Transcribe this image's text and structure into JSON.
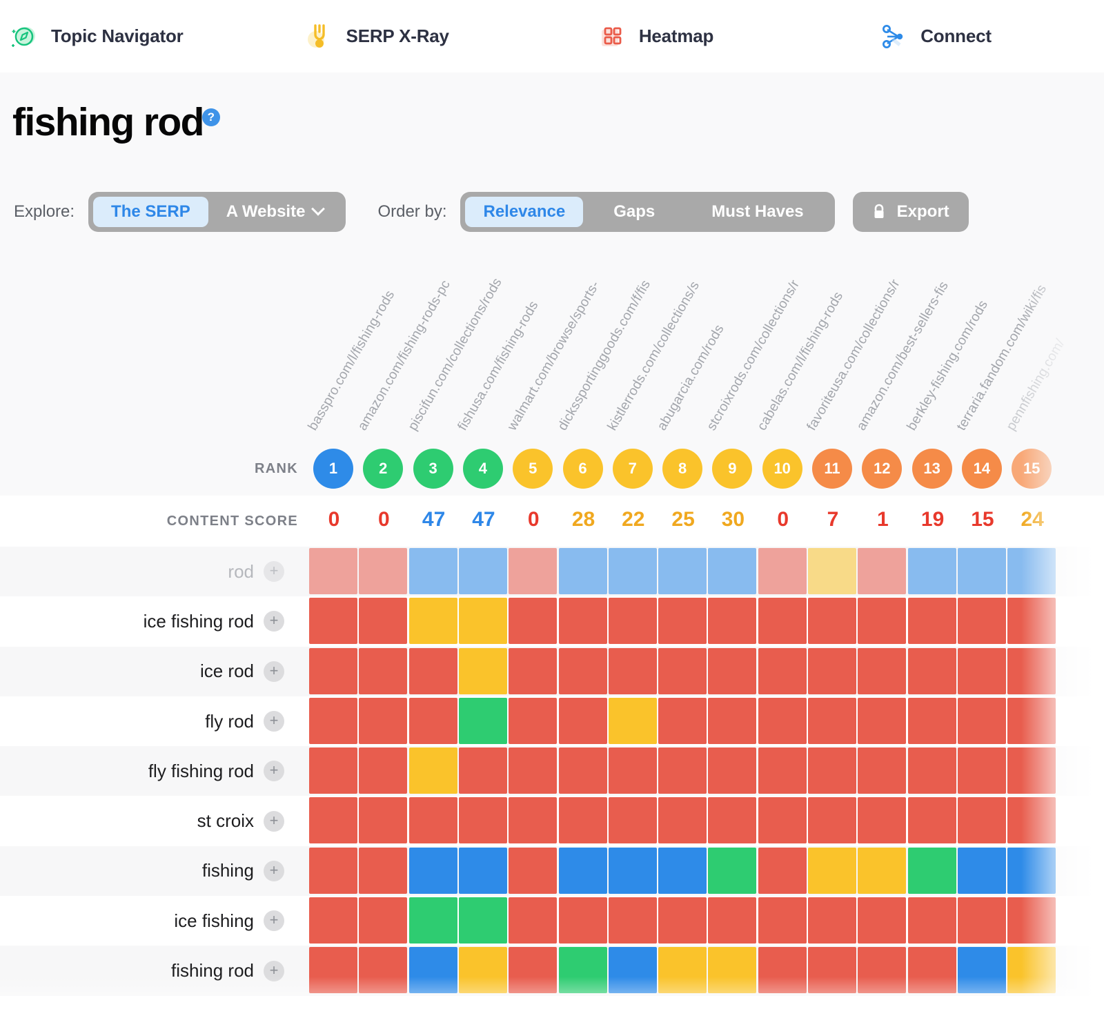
{
  "nav": {
    "items": [
      {
        "label": "Topic Navigator",
        "icon": "compass-icon",
        "active": false
      },
      {
        "label": "SERP X-Ray",
        "icon": "medal-icon",
        "active": false
      },
      {
        "label": "Heatmap",
        "icon": "grid-squares-icon",
        "active": true
      },
      {
        "label": "Connect",
        "icon": "node-graph-icon",
        "active": false
      }
    ],
    "active_underline_color": "#ea5a48"
  },
  "header": {
    "keyword": "fishing rod",
    "help_badge": "?",
    "explore_label": "Explore:",
    "explore_options": [
      {
        "label": "The SERP",
        "active": true,
        "has_chevron": false
      },
      {
        "label": "A Website",
        "active": false,
        "has_chevron": true
      }
    ],
    "order_label": "Order by:",
    "order_options": [
      {
        "label": "Relevance",
        "active": true
      },
      {
        "label": "Gaps",
        "active": false
      },
      {
        "label": "Must Haves",
        "active": false
      }
    ],
    "export_label": "Export",
    "export_icon": "lock-icon"
  },
  "table": {
    "rank_row_label": "RANK",
    "score_row_label": "CONTENT SCORE",
    "add_icon": "plus-icon",
    "columns": [
      {
        "url": "basspro.com/l/fishing-rods",
        "rank": 1,
        "rank_color": "#2e8be8",
        "score": 0,
        "score_color": "#e8392c"
      },
      {
        "url": "amazon.com/fishing-rods-pc",
        "rank": 2,
        "rank_color": "#2ecc71",
        "score": 0,
        "score_color": "#e8392c"
      },
      {
        "url": "piscifun.com/collections/rods",
        "rank": 3,
        "rank_color": "#2ecc71",
        "score": 47,
        "score_color": "#2e87e8"
      },
      {
        "url": "fishusa.com/fishing-rods",
        "rank": 4,
        "rank_color": "#2ecc71",
        "score": 47,
        "score_color": "#2e87e8"
      },
      {
        "url": "walmart.com/browse/sports-",
        "rank": 5,
        "rank_color": "#fac32b",
        "score": 0,
        "score_color": "#e8392c"
      },
      {
        "url": "dickssportinggoods.com/f/fis",
        "rank": 6,
        "rank_color": "#fac32b",
        "score": 28,
        "score_color": "#f0a81f"
      },
      {
        "url": "kistlerrods.com/collections/s",
        "rank": 7,
        "rank_color": "#fac32b",
        "score": 22,
        "score_color": "#f0a81f"
      },
      {
        "url": "abugarcia.com/rods",
        "rank": 8,
        "rank_color": "#fac32b",
        "score": 25,
        "score_color": "#f0a81f"
      },
      {
        "url": "stcroixrods.com/collections/r",
        "rank": 9,
        "rank_color": "#fac32b",
        "score": 30,
        "score_color": "#f0a81f"
      },
      {
        "url": "cabelas.com/l/fishing-rods",
        "rank": 10,
        "rank_color": "#fac32b",
        "score": 0,
        "score_color": "#e8392c"
      },
      {
        "url": "favoriteusa.com/collections/r",
        "rank": 11,
        "rank_color": "#f58b48",
        "score": 7,
        "score_color": "#e8392c"
      },
      {
        "url": "amazon.com/best-sellers-fis",
        "rank": 12,
        "rank_color": "#f58b48",
        "score": 1,
        "score_color": "#e8392c"
      },
      {
        "url": "berkley-fishing.com/rods",
        "rank": 13,
        "rank_color": "#f58b48",
        "score": 19,
        "score_color": "#e8392c"
      },
      {
        "url": "terraria.fandom.com/wiki/fis",
        "rank": 14,
        "rank_color": "#f58b48",
        "score": 15,
        "score_color": "#e8392c"
      },
      {
        "url": "pennfishing.com/",
        "rank": 15,
        "rank_color": "#f8a877",
        "score": 24,
        "score_color": "#f0a81f"
      }
    ],
    "rows": [
      {
        "term": "fishing rod",
        "faded": false,
        "cells": [
          "red",
          "red",
          "blue",
          "yellow",
          "red",
          "green",
          "blue",
          "yellow",
          "yellow",
          "red",
          "red",
          "red",
          "red",
          "blue",
          "yellow"
        ]
      },
      {
        "term": "ice fishing",
        "faded": false,
        "cells": [
          "red",
          "red",
          "green",
          "green",
          "red",
          "red",
          "red",
          "red",
          "red",
          "red",
          "red",
          "red",
          "red",
          "red",
          "red"
        ]
      },
      {
        "term": "fishing",
        "faded": false,
        "cells": [
          "red",
          "red",
          "blue",
          "blue",
          "red",
          "blue",
          "blue",
          "blue",
          "green",
          "red",
          "yellow",
          "yellow",
          "green",
          "blue",
          "blue"
        ]
      },
      {
        "term": "st croix",
        "faded": false,
        "cells": [
          "red",
          "red",
          "red",
          "red",
          "red",
          "red",
          "red",
          "red",
          "red",
          "red",
          "red",
          "red",
          "red",
          "red",
          "red"
        ]
      },
      {
        "term": "fly fishing rod",
        "faded": false,
        "cells": [
          "red",
          "red",
          "yellow",
          "red",
          "red",
          "red",
          "red",
          "red",
          "red",
          "red",
          "red",
          "red",
          "red",
          "red",
          "red"
        ]
      },
      {
        "term": "fly rod",
        "faded": false,
        "cells": [
          "red",
          "red",
          "red",
          "green",
          "red",
          "red",
          "yellow",
          "red",
          "red",
          "red",
          "red",
          "red",
          "red",
          "red",
          "red"
        ]
      },
      {
        "term": "ice rod",
        "faded": false,
        "cells": [
          "red",
          "red",
          "red",
          "yellow",
          "red",
          "red",
          "red",
          "red",
          "red",
          "red",
          "red",
          "red",
          "red",
          "red",
          "red"
        ]
      },
      {
        "term": "ice fishing rod",
        "faded": false,
        "cells": [
          "red",
          "red",
          "yellow",
          "yellow",
          "red",
          "red",
          "red",
          "red",
          "red",
          "red",
          "red",
          "red",
          "red",
          "red",
          "red"
        ]
      },
      {
        "term": "rod",
        "faded": true,
        "cells": [
          "red",
          "red",
          "blue",
          "blue",
          "red",
          "blue",
          "blue",
          "blue",
          "blue",
          "red",
          "yellow",
          "red",
          "blue",
          "blue",
          "blue"
        ]
      }
    ],
    "cell_colors": {
      "red": "#e85d4e",
      "blue": "#2e8be8",
      "yellow": "#fac32b",
      "green": "#2ecc71"
    }
  }
}
